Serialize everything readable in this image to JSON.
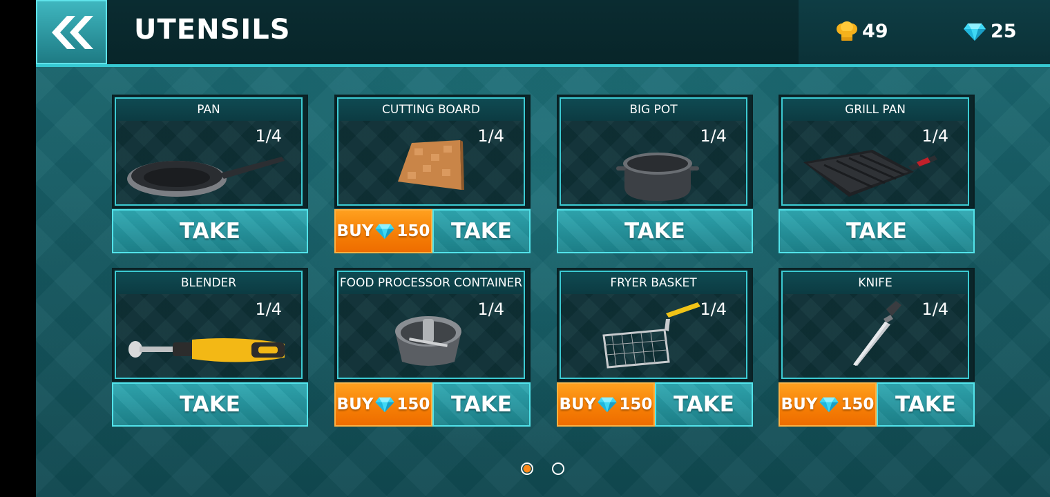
{
  "header": {
    "title": "UTENSILS",
    "back_icon": "double-chevron-left-icon",
    "chef_coins": "49",
    "gems": "25"
  },
  "items": [
    {
      "name": "PAN",
      "count": "1/4",
      "take": "TAKE",
      "buy": null
    },
    {
      "name": "CUTTING BOARD",
      "count": "1/4",
      "take": "TAKE",
      "buy": {
        "label": "BUY",
        "price": "150"
      }
    },
    {
      "name": "BIG POT",
      "count": "1/4",
      "take": "TAKE",
      "buy": null
    },
    {
      "name": "GRILL PAN",
      "count": "1/4",
      "take": "TAKE",
      "buy": null
    },
    {
      "name": "BLENDER",
      "count": "1/4",
      "take": "TAKE",
      "buy": null
    },
    {
      "name": "FOOD PROCESSOR CONTAINER",
      "count": "1/4",
      "take": "TAKE",
      "buy": {
        "label": "BUY",
        "price": "150"
      }
    },
    {
      "name": "FRYER BASKET",
      "count": "1/4",
      "take": "TAKE",
      "buy": {
        "label": "BUY",
        "price": "150"
      }
    },
    {
      "name": "KNIFE",
      "count": "1/4",
      "take": "TAKE",
      "buy": {
        "label": "BUY",
        "price": "150"
      }
    }
  ],
  "pagination": {
    "pages": 2,
    "current": 1
  },
  "colors": {
    "accent": "#37c9d2",
    "buy": "#f57d05",
    "background": "#175c64"
  }
}
